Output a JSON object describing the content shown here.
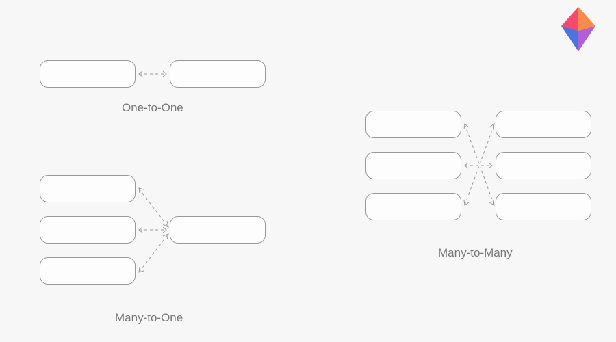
{
  "logo": {
    "name": "diamond-logo"
  },
  "diagrams": {
    "one_to_one": {
      "label": "One-to-One"
    },
    "many_to_one": {
      "label": "Many-to-One"
    },
    "many_to_many": {
      "label": "Many-to-Many"
    }
  }
}
